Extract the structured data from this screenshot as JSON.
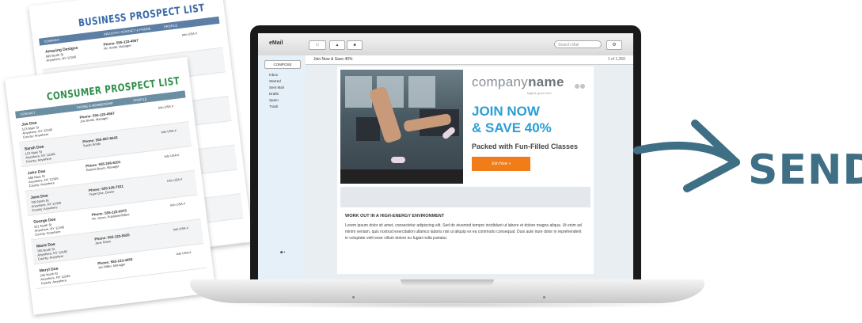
{
  "business_sheet": {
    "title": "BUSINESS PROSPECT LIST",
    "header_columns": [
      "COMPANY",
      "INDUSTRY CONTACT & PHONE",
      "PROFILE"
    ],
    "rows": [
      {
        "name": "Amazing Designs",
        "addr": "999 North St",
        "city": "Anywhere, NV 12345",
        "phone": "Phone: 555-123-4567",
        "contact": "Mr. Smith, Manager",
        "profile": "Info USA #"
      }
    ]
  },
  "consumer_sheet": {
    "title": "CONSUMER PROSPECT LIST",
    "header_columns": [
      "CONTACT",
      "PHONE & MEMBERSHIP",
      "PROFILE"
    ],
    "rows": [
      {
        "name": "Joe Doe",
        "addr": "123 Main St",
        "city": "Anywhere, NY 12345",
        "county": "County: Anywhere",
        "phone": "Phone: 555-123-4567",
        "contact": "Joe Smith, Manager",
        "profile": "Info USA #"
      },
      {
        "name": "Sarah Doe",
        "addr": "123 Main St",
        "city": "Anywhere, NY 12345",
        "county": "County: Anywhere",
        "phone": "Phone: 555-987-6543",
        "contact": "Sarah Smith",
        "profile": "Info USA #"
      },
      {
        "name": "John Doe",
        "addr": "456 Main St",
        "city": "Anywhere, NY 12345",
        "county": "County: Anywhere",
        "phone": "Phone: 555-246-8101",
        "contact": "Retired Buyer, Manager",
        "profile": "Info USA #"
      },
      {
        "name": "Jane Doe",
        "addr": "789 North St",
        "city": "Anywhere, NY 12345",
        "county": "County: Anywhere",
        "phone": "Phone: 555-135-7911",
        "contact": "Team Doe, Owner",
        "profile": "Info USA #"
      },
      {
        "name": "George Doe",
        "addr": "321 North St",
        "city": "Anywhere, NY 12345",
        "county": "County: Anywhere",
        "phone": "Phone: 555-123-0075",
        "contact": "Mr. Jones, Publisher/Editor",
        "profile": "Info USA #"
      },
      {
        "name": "Marie Doe",
        "addr": "765 North St",
        "city": "Anywhere, NY 12345",
        "county": "County: Anywhere",
        "phone": "Phone: 555-123-5555",
        "contact": "Jane Owen",
        "profile": "Info USA #"
      },
      {
        "name": "Meryl Doe",
        "addr": "246 North St",
        "city": "Anywhere, NY 12345",
        "county": "County: Anywhere",
        "phone": "Phone: 555-123-4455",
        "contact": "Jon Miller, Manager",
        "profile": "Info USA #"
      }
    ]
  },
  "mail_client": {
    "logo": "eMail",
    "compose_label": "COMPOSE",
    "folders": [
      "Inbox",
      "Starred",
      "Sent Mail",
      "Drafts",
      "Spam",
      "Trash"
    ],
    "search_placeholder": "Search Mail",
    "subject": "Join Now & Save 40%",
    "subject_tools": "1 of 1,250"
  },
  "email": {
    "brand_regular": "company",
    "brand_bold": "name",
    "tagline": "tagline goes here",
    "headline_line1": "JOIN NOW",
    "headline_line2": "& SAVE 40%",
    "subhead": "Packed with Fun-Filled Classes",
    "button_label": "Join Now »",
    "body_title": "WORK OUT IN A HIGH-ENERGY ENVIRONMENT",
    "body_text": "Lorem ipsum dolor sit amet, consectetur adipiscing elit. Sed do eiusmod tempor incididunt ut labore et dolore magna aliqua. Ut enim ad minim veniam, quis nostrud exercitation ullamco laboris nisi ut aliquip ex ea commodo consequat. Duis aute irure dolor in reprehenderit in voluptate velit esse cillum dolore eu fugiat nulla pariatur."
  },
  "send": {
    "label": "SEND",
    "color": "#3e6f85"
  },
  "colors": {
    "headline": "#2a9fd6",
    "button": "#f07d18",
    "business_title": "#3a6aa8",
    "consumer_title": "#2f8f4a"
  }
}
